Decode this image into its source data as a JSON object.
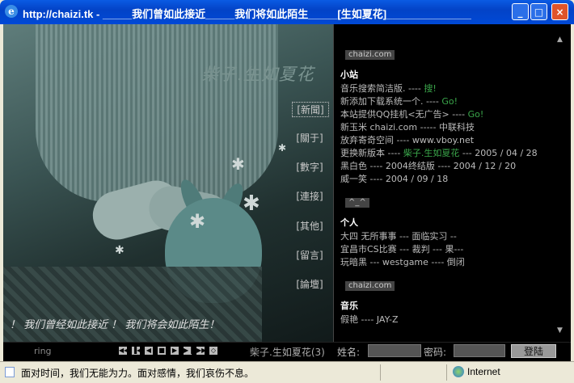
{
  "window": {
    "title": "http://chaizi.tk - _____我们曾如此接近_____我们将如此陌生_____[生如夏花]____________________...",
    "minimize": "_",
    "maximize": "□",
    "close": "×",
    "icon": "ie-icon"
  },
  "site": {
    "title": "柴子.生如夏花",
    "slogan": "！ 我们曾经如此接近 ！ 我们将会如此陌生！",
    "nav": [
      "[新聞]",
      "[關于]",
      "[數字]",
      "[連接]",
      "[其他]",
      "[留言]",
      "[論壇]"
    ]
  },
  "panel": {
    "tag1": "chaizi.com",
    "section1": "小站",
    "news": [
      {
        "text": "音乐搜索简洁版. ---- ",
        "link": "搜!"
      },
      {
        "text": "新添加下载系统一个. ---- ",
        "link": "Go!"
      },
      {
        "text": "本站提供QQ挂机<无广告> ---- ",
        "link": "Go!"
      },
      {
        "text": "新玉米  chaizi.com ----- 中联科技",
        "link": ""
      },
      {
        "text": "放弃寄奇空间  ---- www.vboy.net",
        "link": ""
      },
      {
        "text": "更换新版本 ---- ",
        "link": "柴子.生如夏花",
        "after": " --- 2005 / 04 / 28"
      },
      {
        "text": "黑白色 ---- 2004终结版 ---- 2004 / 12 / 20",
        "link": ""
      },
      {
        "text": "威一笑 ---- 2004 / 09 / 18",
        "link": ""
      }
    ],
    "tag2": "^_^",
    "section2": "个人",
    "personal": [
      "大四  无所事事 --- 面临实习 --",
      "宜昌市CS比赛 --- 裁判 --- 果---",
      "玩暗黑 --- westgame ---- 倒闭"
    ],
    "tag3": "chaizi.com",
    "section3": "音乐",
    "music": [
      "假艳 ---- JAY-Z"
    ]
  },
  "player": {
    "ring": "ring",
    "song": "柴子.生如夏花(3)",
    "controls": [
      "◀◀",
      "▐◀",
      "◀",
      "■",
      "▶",
      "▶▐",
      "▶▶",
      "◇"
    ]
  },
  "login": {
    "name_label": "姓名:",
    "pass_label": "密码:",
    "button": "登陆"
  },
  "statusbar": {
    "text": "面对时间，我们无能为力。面对感情，我们哀伤不息。",
    "zone": "Internet"
  }
}
